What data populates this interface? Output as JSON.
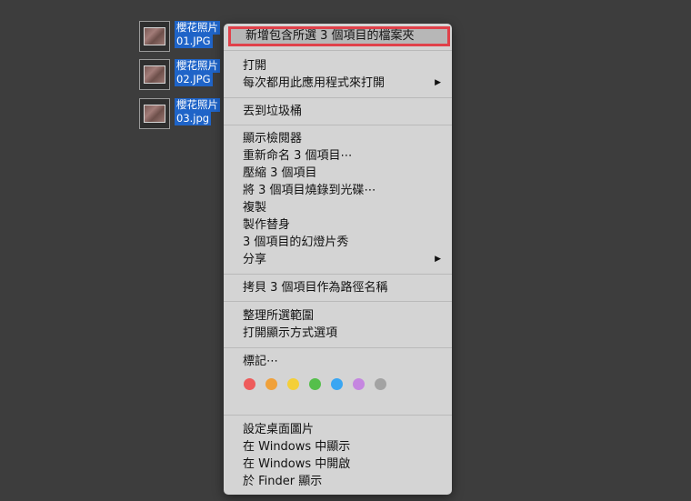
{
  "desktop": {
    "files": [
      {
        "line1": "櫻花照片",
        "line2": "01.JPG"
      },
      {
        "line1": "櫻花照片",
        "line2": "02.JPG"
      },
      {
        "line1": "櫻花照片",
        "line2": "03.jpg"
      }
    ]
  },
  "menu": {
    "new_folder": "新增包含所選 3 個項目的檔案夾",
    "open": "打開",
    "always_open_with": "每次都用此應用程式來打開",
    "move_to_trash": "丟到垃圾桶",
    "show_inspector": "顯示檢閱器",
    "rename": "重新命名 3 個項目⋯",
    "compress": "壓縮 3 個項目",
    "burn": "將 3 個項目燒錄到光碟⋯",
    "duplicate": "複製",
    "make_alias": "製作替身",
    "slideshow": "3 個項目的幻燈片秀",
    "share": "分享",
    "copy_path": "拷貝 3 個項目作為路徑名稱",
    "clean_up": "整理所選範圍",
    "view_options": "打開顯示方式選項",
    "tags": "標記⋯",
    "tag_colors": [
      "#ee5b5b",
      "#f0a13a",
      "#f4cf39",
      "#55bf4b",
      "#3aa6f2",
      "#c586e0",
      "#a3a3a3"
    ],
    "set_desktop": "設定桌面圖片",
    "show_in_windows": "在 Windows 中顯示",
    "open_in_windows": "在 Windows 中開啟",
    "show_in_finder": "於 Finder 顯示",
    "submenu_arrow": "▶"
  }
}
